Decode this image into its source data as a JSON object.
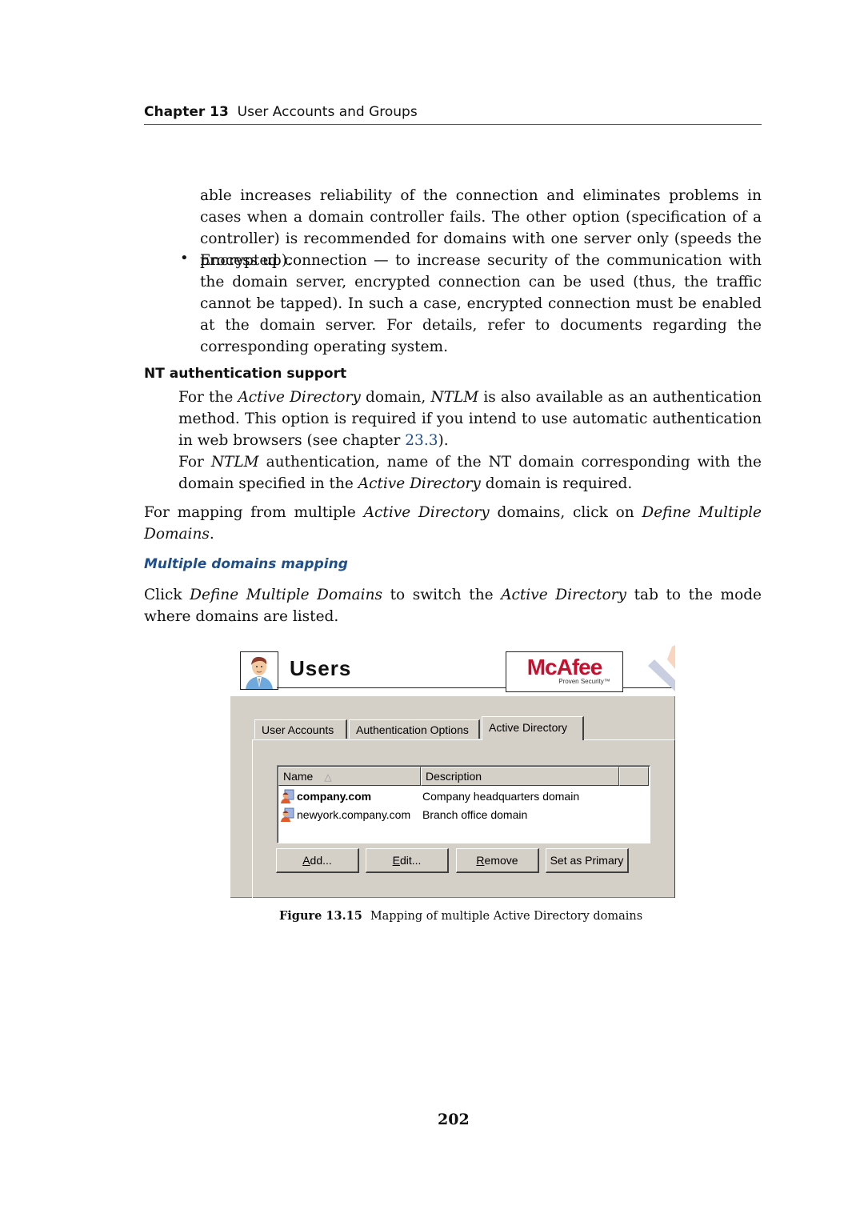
{
  "running_head": {
    "chapter_label": "Chapter 13",
    "chapter_title": "User Accounts and Groups"
  },
  "continued_paragraph": "able increases reliability of the connection and eliminates problems in cases when a domain controller fails. The other option (specification of a controller) is recommended for domains with one server only (speeds the process up).",
  "bullet_item": {
    "bullet": "•",
    "text": "Encrypted connection — to increase security of the communication with the domain server, encrypted connection can be used (thus, the traffic cannot be tapped). In such a case, encrypted connection must be enabled at the domain server. For details, refer to documents regarding the corresponding operating system."
  },
  "nt_section": {
    "heading": "NT authentication support",
    "p1_a": "For the ",
    "p1_i1": "Active Directory",
    "p1_b": " domain, ",
    "p1_i2": "NTLM",
    "p1_c": " is also available as an authentication method. This option is required if you intend to use automatic authentication in web browsers (see chapter ",
    "p1_link": "23.3",
    "p1_d": ").",
    "p2_a": "For ",
    "p2_i1": "NTLM",
    "p2_b": " authentication, name of the NT domain corresponding with the domain specified in the ",
    "p2_i2": "Active Directory",
    "p2_c": " domain is required."
  },
  "mapping_para": {
    "a": "For mapping from multiple ",
    "i1": "Active Directory",
    "b": " domains, click on ",
    "i2": "Define Multiple Domains",
    "c": "."
  },
  "subsection": {
    "heading": "Multiple domains mapping",
    "a": "Click ",
    "i1": "Define Multiple Domains",
    "b": " to switch the ",
    "i2": "Active Directory",
    "c": " tab to the mode where domains are listed."
  },
  "figure": {
    "header_title": "Users",
    "logo_text": "McAfee",
    "logo_tagline": "Proven Security™",
    "tabs": [
      {
        "label": "User Accounts",
        "active": false
      },
      {
        "label": "Authentication Options",
        "active": false
      },
      {
        "label": "Active Directory",
        "active": true
      }
    ],
    "list": {
      "columns": [
        "Name",
        "Description",
        ""
      ],
      "sort_indicator": "△",
      "rows": [
        {
          "name": "company.com",
          "description": "Company headquarters domain",
          "primary": true
        },
        {
          "name": "newyork.company.com",
          "description": "Branch office domain",
          "primary": false
        }
      ]
    },
    "buttons": [
      {
        "mnemonic": "A",
        "rest": "dd..."
      },
      {
        "mnemonic": "E",
        "rest": "dit..."
      },
      {
        "mnemonic": "R",
        "rest": "emove"
      },
      {
        "mnemonic": "",
        "rest": "Set as Primary"
      }
    ],
    "colors": {
      "dialog_bg": "#d4d0c8",
      "logo_red": "#c8102e"
    }
  },
  "caption": {
    "label": "Figure 13.15",
    "text": "Mapping of multiple Active Directory domains"
  },
  "page_number": "202",
  "colors": {
    "link": "#1f4e8c",
    "subheading": "#1f4e8c"
  }
}
